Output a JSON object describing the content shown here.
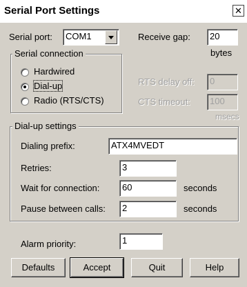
{
  "window": {
    "title": "Serial Port Settings",
    "close_glyph": "✕"
  },
  "serial_port": {
    "label": "Serial port:",
    "value": "COM1"
  },
  "receive_gap": {
    "label": "Receive gap:",
    "value": "20",
    "unit": "bytes"
  },
  "serial_connection": {
    "label": "Serial connection",
    "options": [
      {
        "label": "Hardwired",
        "checked": false
      },
      {
        "label": "Dial-up",
        "checked": true
      },
      {
        "label": "Radio (RTS/CTS)",
        "checked": false
      }
    ]
  },
  "rts_delay_off": {
    "label": "RTS delay off:",
    "value": "0"
  },
  "cts_timeout": {
    "label": "CTS timeout:",
    "value": "100",
    "unit": "msecs"
  },
  "dialup": {
    "label": "Dial-up settings",
    "prefix_label": "Dialing prefix:",
    "prefix_value": "ATX4MVEDT",
    "retries_label": "Retries:",
    "retries_value": "3",
    "wait_label": "Wait for connection:",
    "wait_value": "60",
    "wait_unit": "seconds",
    "pause_label": "Pause between calls:",
    "pause_value": "2",
    "pause_unit": "seconds"
  },
  "alarm_priority": {
    "label": "Alarm priority:",
    "value": "1"
  },
  "buttons": {
    "defaults": "Defaults",
    "accept": "Accept",
    "quit": "Quit",
    "help": "Help"
  }
}
